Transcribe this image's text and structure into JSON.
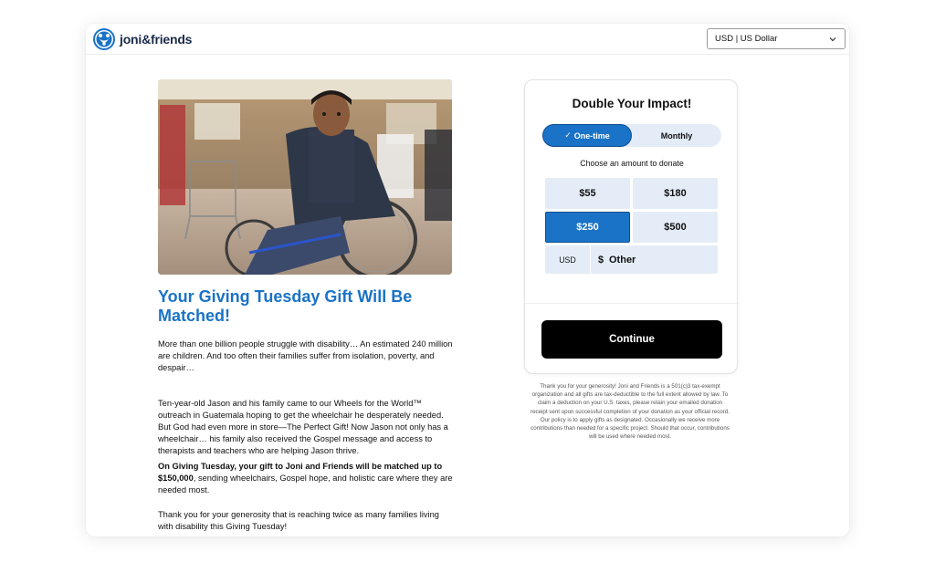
{
  "header": {
    "logo_text": "joni&friends",
    "currency_select": "USD | US Dollar"
  },
  "article": {
    "headline": "Your Giving Tuesday Gift Will Be Matched!",
    "para1": "More than one billion people struggle with disability… An estimated 240 million are children. And too often their families suffer from isolation, poverty, and despair…",
    "para2": "Ten-year-old Jason and his family came to our Wheels for the World™ outreach in Guatemala hoping to get the wheelchair he desperately needed. But God had even more in store—The Perfect Gift! Now Jason not only has a wheelchair… his family also received the Gospel message and access to therapists and teachers who are helping Jason thrive.",
    "para3_bold": "On Giving Tuesday, your gift to Joni and Friends will be matched up to $150,000",
    "para3_rest": ", sending wheelchairs, Gospel hope, and holistic care where they are needed most.",
    "para4": "Thank you for your generosity that is reaching twice as many families living with disability this Giving Tuesday!"
  },
  "donation": {
    "title": "Double Your Impact!",
    "frequency": {
      "one_time": "One-time",
      "monthly": "Monthly",
      "selected": "one_time"
    },
    "choose_label": "Choose an amount to donate",
    "amounts": [
      "$55",
      "$180",
      "$250",
      "$500"
    ],
    "selected_amount": "$250",
    "other": {
      "currency": "USD",
      "symbol": "$",
      "placeholder": "Other"
    },
    "continue_label": "Continue",
    "disclaimer": "Thank you for your generosity! Joni and Friends is a 501(c)3 tax-exempt organization and all gifts are tax-deductible to the full extent allowed by law. To claim a deduction on your U.S. taxes, please retain your emailed donation receipt sent upon successful completion of your donation as your official record. Our policy is to apply gifts as designated. Occasionally we receive more contributions than needed for a specific project. Should that occur, contributions will be used where needed most."
  },
  "colors": {
    "brand_blue": "#1a73c6",
    "option_bg": "#e4ecf7",
    "continue_bg": "#000000"
  }
}
